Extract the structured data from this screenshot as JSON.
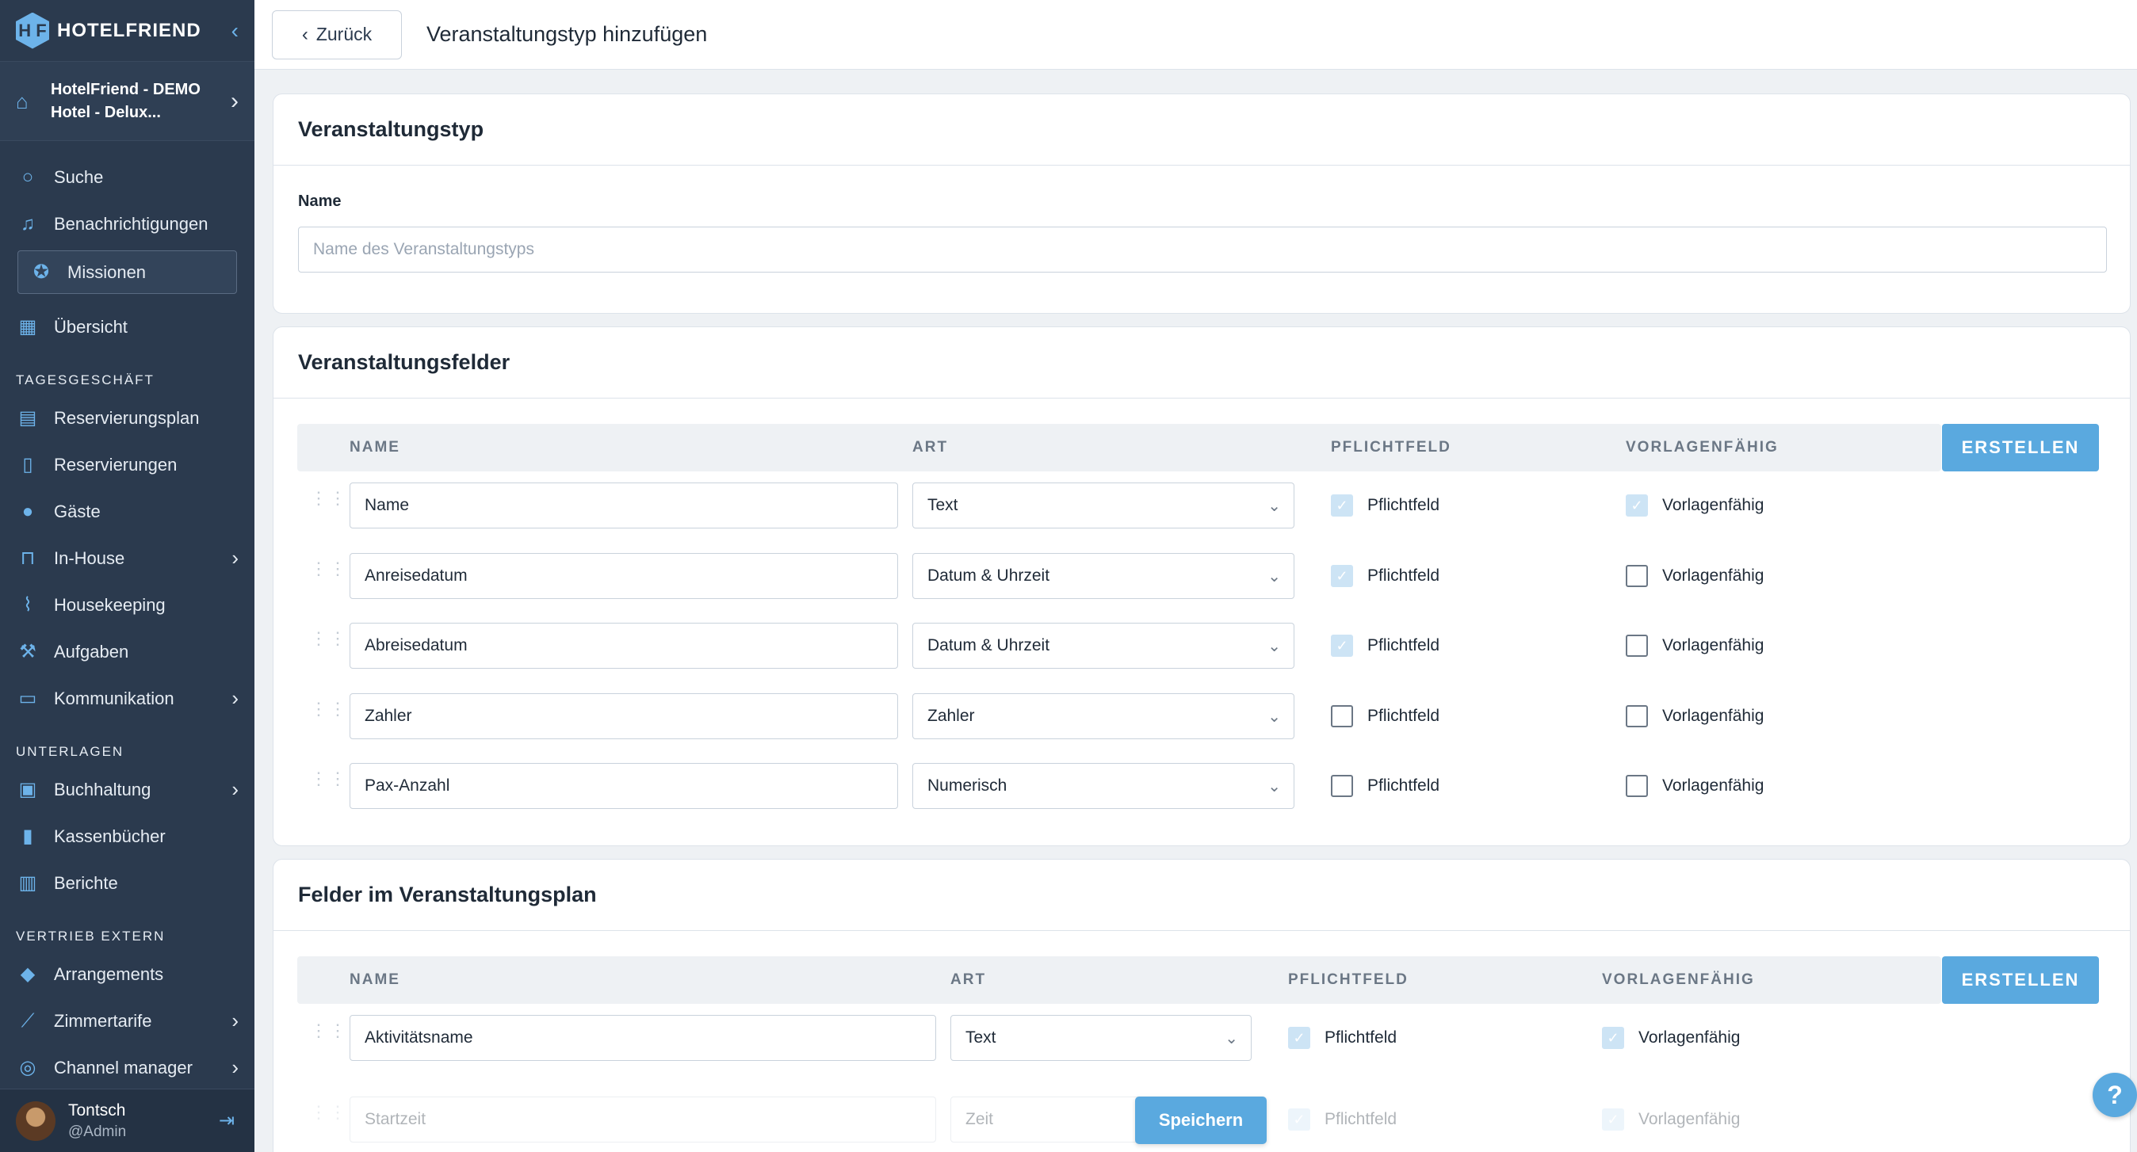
{
  "brand": {
    "name": "HOTELFRIEND",
    "mark": "H F"
  },
  "hotel": {
    "name": "HotelFriend - DEMO Hotel - Delux..."
  },
  "nav": {
    "search": "Suche",
    "notifications": "Benachrichtigungen",
    "missions": "Missionen",
    "overview": "Übersicht",
    "section_daily": "TAGESGESCHÄFT",
    "reservation_plan": "Reservierungsplan",
    "reservations": "Reservierungen",
    "guests": "Gäste",
    "in_house": "In-House",
    "housekeeping": "Housekeeping",
    "tasks": "Aufgaben",
    "communication": "Kommunikation",
    "section_documents": "UNTERLAGEN",
    "accounting": "Buchhaltung",
    "cashbooks": "Kassenbücher",
    "reports": "Berichte",
    "section_sales": "VERTRIEB EXTERN",
    "arrangements": "Arrangements",
    "room_rates": "Zimmertarife",
    "channel_manager": "Channel manager"
  },
  "user": {
    "name": "Tontsch",
    "role": "@Admin"
  },
  "topbar": {
    "back_label": "Zurück",
    "title": "Veranstaltungstyp hinzufügen"
  },
  "event_type": {
    "header": "Veranstaltungstyp",
    "name_label": "Name",
    "name_placeholder": "Name des Veranstaltungstyps"
  },
  "event_fields": {
    "header": "Veranstaltungsfelder",
    "columns": {
      "name": "NAME",
      "type": "ART",
      "required": "PFLICHTFELD",
      "template": "VORLAGENFÄHIG"
    },
    "create_label": "ERSTELLEN",
    "rows": [
      {
        "name": "Name",
        "type": "Text",
        "required_label": "Pflichtfeld",
        "required": true,
        "template_label": "Vorlagenfähig",
        "template": true
      },
      {
        "name": "Anreisedatum",
        "type": "Datum & Uhrzeit",
        "required_label": "Pflichtfeld",
        "required": true,
        "template_label": "Vorlagenfähig",
        "template": false
      },
      {
        "name": "Abreisedatum",
        "type": "Datum & Uhrzeit",
        "required_label": "Pflichtfeld",
        "required": true,
        "template_label": "Vorlagenfähig",
        "template": false
      },
      {
        "name": "Zahler",
        "type": "Zahler",
        "required_label": "Pflichtfeld",
        "required": false,
        "template_label": "Vorlagenfähig",
        "template": false
      },
      {
        "name": "Pax-Anzahl",
        "type": "Numerisch",
        "required_label": "Pflichtfeld",
        "required": false,
        "template_label": "Vorlagenfähig",
        "template": false
      }
    ]
  },
  "plan_fields": {
    "header": "Felder im Veranstaltungsplan",
    "columns": {
      "name": "NAME",
      "type": "ART",
      "required": "PFLICHTFELD",
      "template": "VORLAGENFÄHIG"
    },
    "create_label": "ERSTELLEN",
    "rows": [
      {
        "name": "Aktivitätsname",
        "type": "Text",
        "required_label": "Pflichtfeld",
        "required": true,
        "template_label": "Vorlagenfähig",
        "template": true
      },
      {
        "name": "Startzeit",
        "type": "Zeit",
        "required_label": "Pflichtfeld",
        "required": true,
        "template_label": "Vorlagenfähig",
        "template": true
      }
    ]
  },
  "footer": {
    "save_label": "Speichern",
    "help_label": "?"
  },
  "colors": {
    "sidebar": "#2b3a4e",
    "accent": "#5aa9df",
    "background": "#eef1f4"
  }
}
